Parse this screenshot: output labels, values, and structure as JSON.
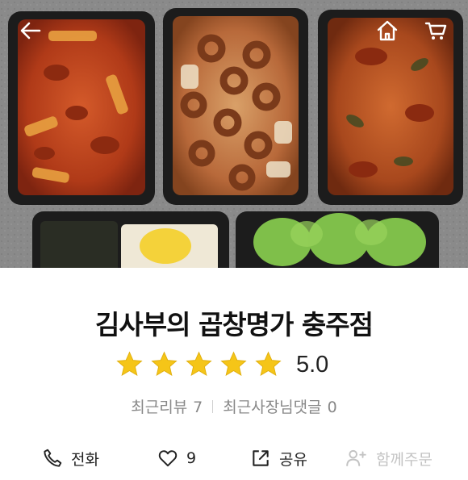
{
  "header": {
    "back_icon": "arrow-left-icon",
    "home_icon": "home-icon",
    "cart_icon": "cart-icon"
  },
  "store": {
    "name": "김사부의 곱창명가 충주점",
    "rating": "5.0",
    "rating_stars": 5,
    "rating_max": 5,
    "star_color": "#F5C518"
  },
  "stats": {
    "recent_reviews_label": "최근리뷰",
    "recent_reviews_count": "7",
    "owner_replies_label": "최근사장님댓글",
    "owner_replies_count": "0"
  },
  "actions": {
    "phone_label": "전화",
    "phone_icon": "phone-icon",
    "like_count": "9",
    "like_icon": "heart-icon",
    "share_label": "공유",
    "share_icon": "share-icon",
    "order_together_label": "함께주문",
    "order_together_icon": "add-person-icon",
    "disabled_color": "#C3C3C3"
  }
}
